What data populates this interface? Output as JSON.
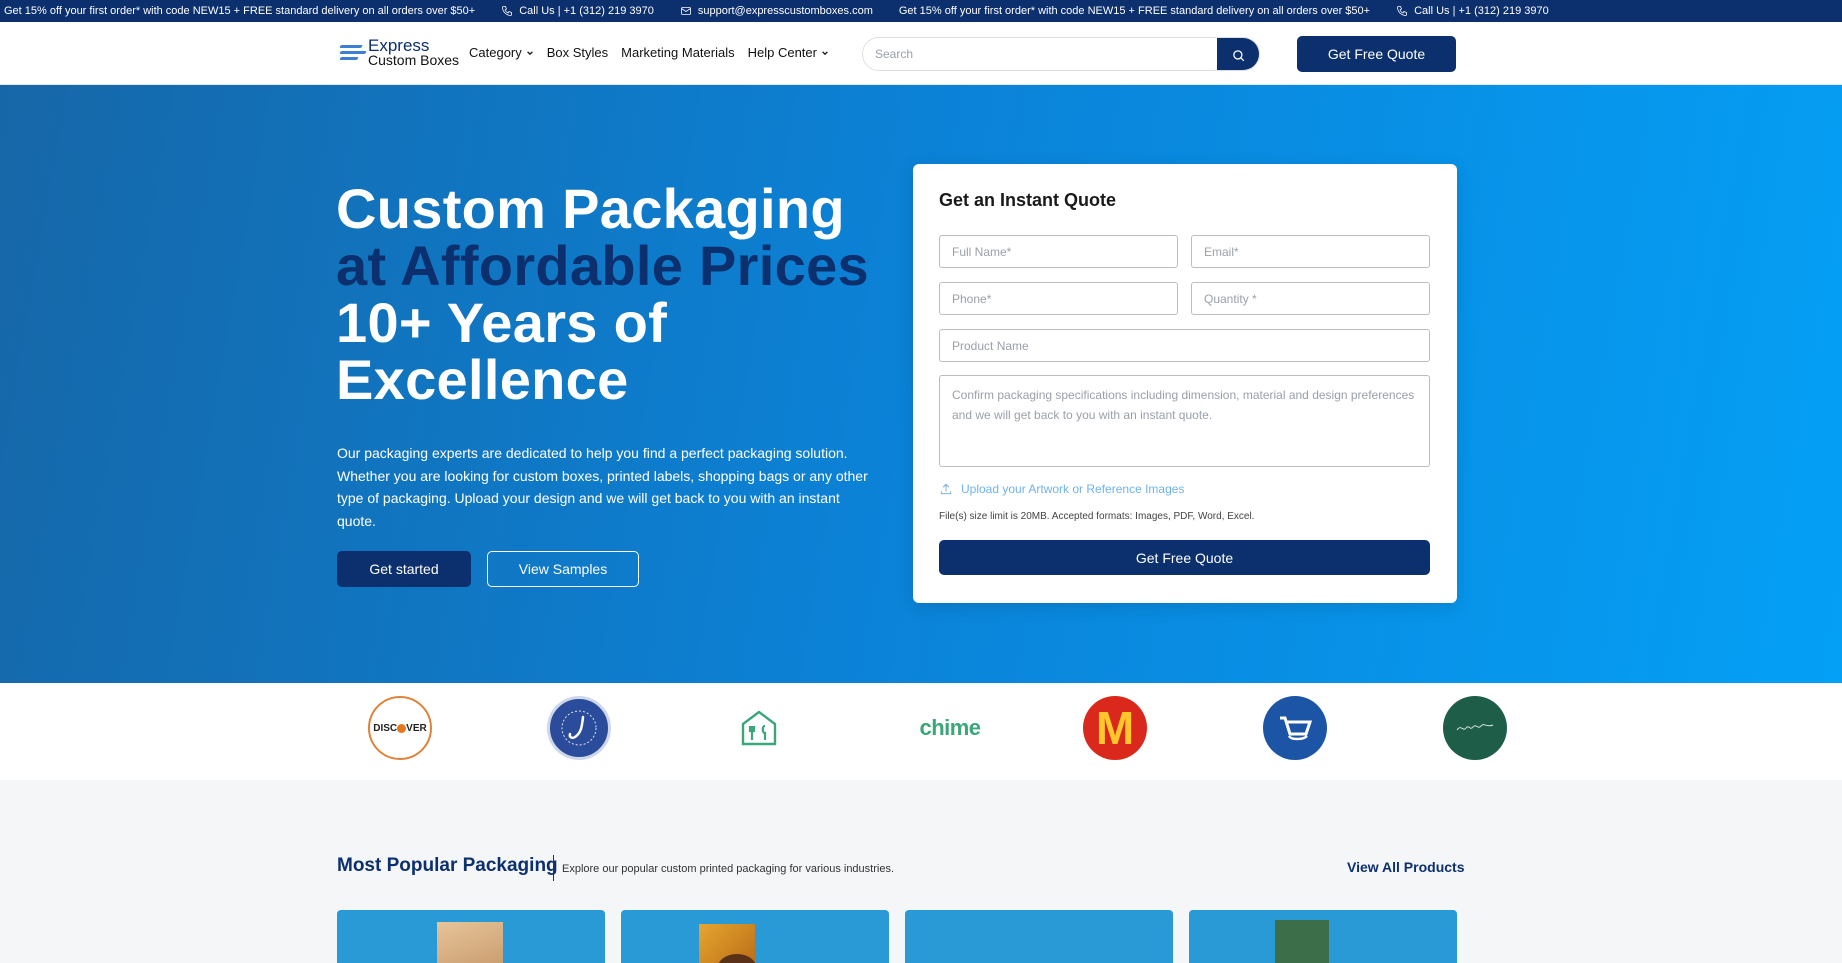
{
  "topbar": {
    "promo": "Get 15% off your first order* with code NEW15 + FREE standard delivery on all orders over $50+",
    "phone": "Call Us | +1 (312) 219 3970",
    "email": "support@expresscustomboxes.com"
  },
  "header": {
    "logo_line1": "Express",
    "logo_line2": "Custom Boxes",
    "nav": [
      {
        "label": "Category",
        "dropdown": true
      },
      {
        "label": "Box Styles",
        "dropdown": false
      },
      {
        "label": "Marketing Materials",
        "dropdown": false
      },
      {
        "label": "Help Center",
        "dropdown": true
      }
    ],
    "search_placeholder": "Search",
    "quote_label": "Get Free Quote"
  },
  "hero": {
    "line1": "Custom Packaging",
    "line2": "at Affordable Prices",
    "line3": "10+ Years of",
    "line4": "Excellence",
    "description": "Our packaging experts are dedicated to help you find a perfect packaging solution. Whether you are looking for custom boxes, printed labels, shopping bags or any other type of packaging. Upload your design and we will get back to you with an instant quote.",
    "btn_start": "Get started",
    "btn_samples": "View Samples"
  },
  "quote_form": {
    "title": "Get an Instant Quote",
    "full_name": "Full Name*",
    "email": "Email*",
    "phone": "Phone*",
    "quantity": "Quantity *",
    "product_name": "Product Name",
    "details": "Confirm packaging specifications including dimension, material and design preferences and we will get back to you with an instant quote.",
    "upload_label": "Upload your Artwork or Reference Images",
    "file_note": "File(s) size limit is 20MB. Accepted formats: Images, PDF, Word, Excel.",
    "submit": "Get Free Quote"
  },
  "logos": {
    "discover": "DISC",
    "discover_end": "VER",
    "chime": "chime",
    "mcd": "M"
  },
  "popular": {
    "title": "Most Popular Packaging",
    "subtitle": "Explore our popular custom printed packaging for various industries.",
    "view_all": "View All Products"
  },
  "colors": {
    "brand_navy": "#0c2f6e",
    "hero_start": "#1667a8",
    "hero_end": "#04a0f6"
  }
}
